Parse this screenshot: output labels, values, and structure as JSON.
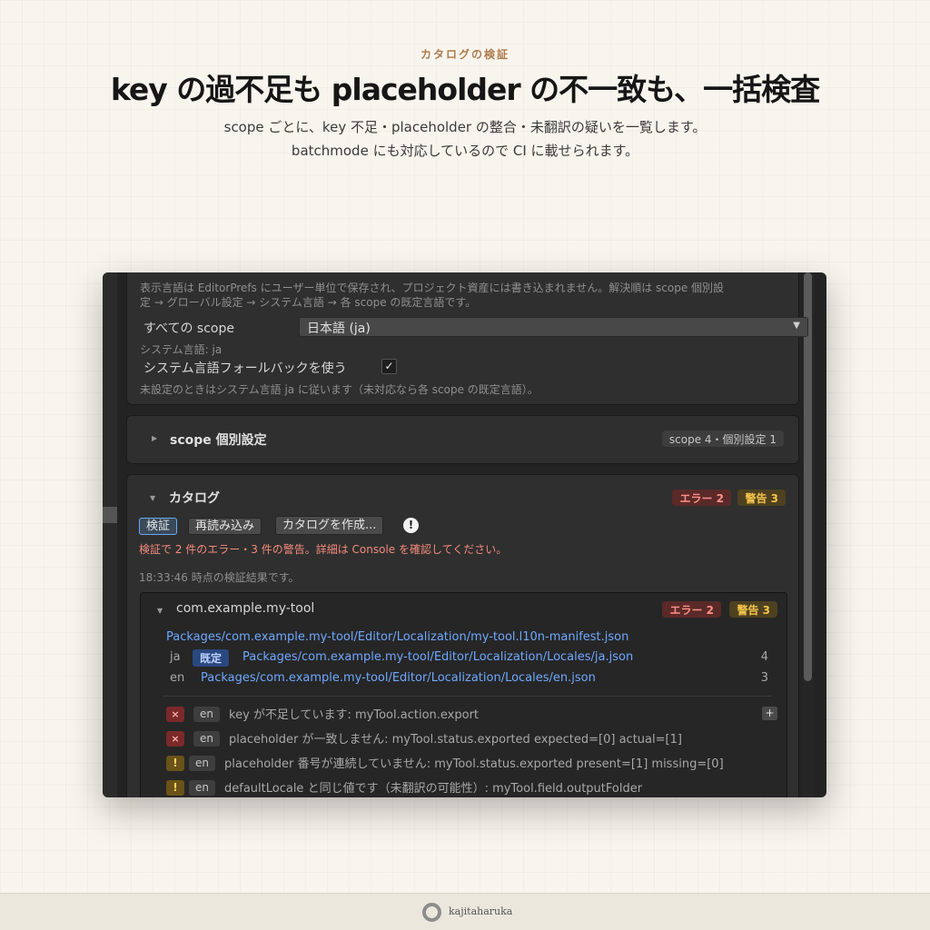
{
  "hero": {
    "eyebrow": "カタログの検証",
    "headline": "key の過不足も placeholder の不一致も、一括検査",
    "subtitle_line1": "scope ごとに、key 不足・placeholder の整合・未翻訳の疑いを一覧します。",
    "subtitle_line2": "batchmode にも対応しているので CI に載せられます。"
  },
  "language_panel": {
    "desc_line1": "表示言語は EditorPrefs にユーザー単位で保存され、プロジェクト資産には書き込まれません。解決順は scope 個別設",
    "desc_line2": "定 → グローバル設定 → システム言語 → 各 scope の既定言語です。",
    "all_scope_label": "すべての scope",
    "dropdown_value": "日本語 (ja)",
    "system_language": "システム言語: ja",
    "fallback_label": "システム言語フォールバックを使う",
    "fallback_checked": true,
    "checkmark": "✓",
    "unset_note": "未設定のときはシステム言語 ja に従います（未対応なら各 scope の既定言語）。"
  },
  "scope_panel": {
    "title": "scope 個別設定",
    "summary": "scope 4・個別設定 1"
  },
  "catalog_panel": {
    "title": "カタログ",
    "error_badge": "エラー 2",
    "warn_badge": "警告 3",
    "buttons": {
      "validate": "検証",
      "reload": "再読み込み",
      "create": "カタログを作成..."
    },
    "info_icon": "!",
    "validation_message": "検証で 2 件のエラー・3 件の警告。詳細は Console を確認してください。",
    "timestamp_note": "18:33:46 時点の検証結果です。",
    "package": {
      "name": "com.example.my-tool",
      "error_badge": "エラー 2",
      "warn_badge": "警告 3",
      "manifest_path": "Packages/com.example.my-tool/Editor/Localization/my-tool.l10n-manifest.json",
      "locales": [
        {
          "code": "ja",
          "default_label": "既定",
          "path": "Packages/com.example.my-tool/Editor/Localization/Locales/ja.json",
          "count": "4"
        },
        {
          "code": "en",
          "path": "Packages/com.example.my-tool/Editor/Localization/Locales/en.json",
          "count": "3"
        }
      ],
      "plus": "+",
      "issues": [
        {
          "severity": "error",
          "icon": "×",
          "locale": "en",
          "message": "key が不足しています: myTool.action.export"
        },
        {
          "severity": "error",
          "icon": "×",
          "locale": "en",
          "message": "placeholder が一致しません: myTool.status.exported expected=[0] actual=[1]"
        },
        {
          "severity": "warning",
          "icon": "!",
          "locale": "en",
          "message": "placeholder 番号が連続していません: myTool.status.exported present=[1] missing=[0]"
        },
        {
          "severity": "warning",
          "icon": "!",
          "locale": "en",
          "message": "defaultLocale と同じ値です（未翻訳の可能性）: myTool.field.outputFolder"
        }
      ]
    }
  },
  "footer": {
    "brand": "kajitaharuka"
  },
  "colors": {
    "page_bg": "#f8f5ee",
    "window_bg": "#232323",
    "link": "#6ea8ff",
    "error": "#ff8f87",
    "warning": "#f4c44c",
    "accent_label": "#b07a4c"
  }
}
